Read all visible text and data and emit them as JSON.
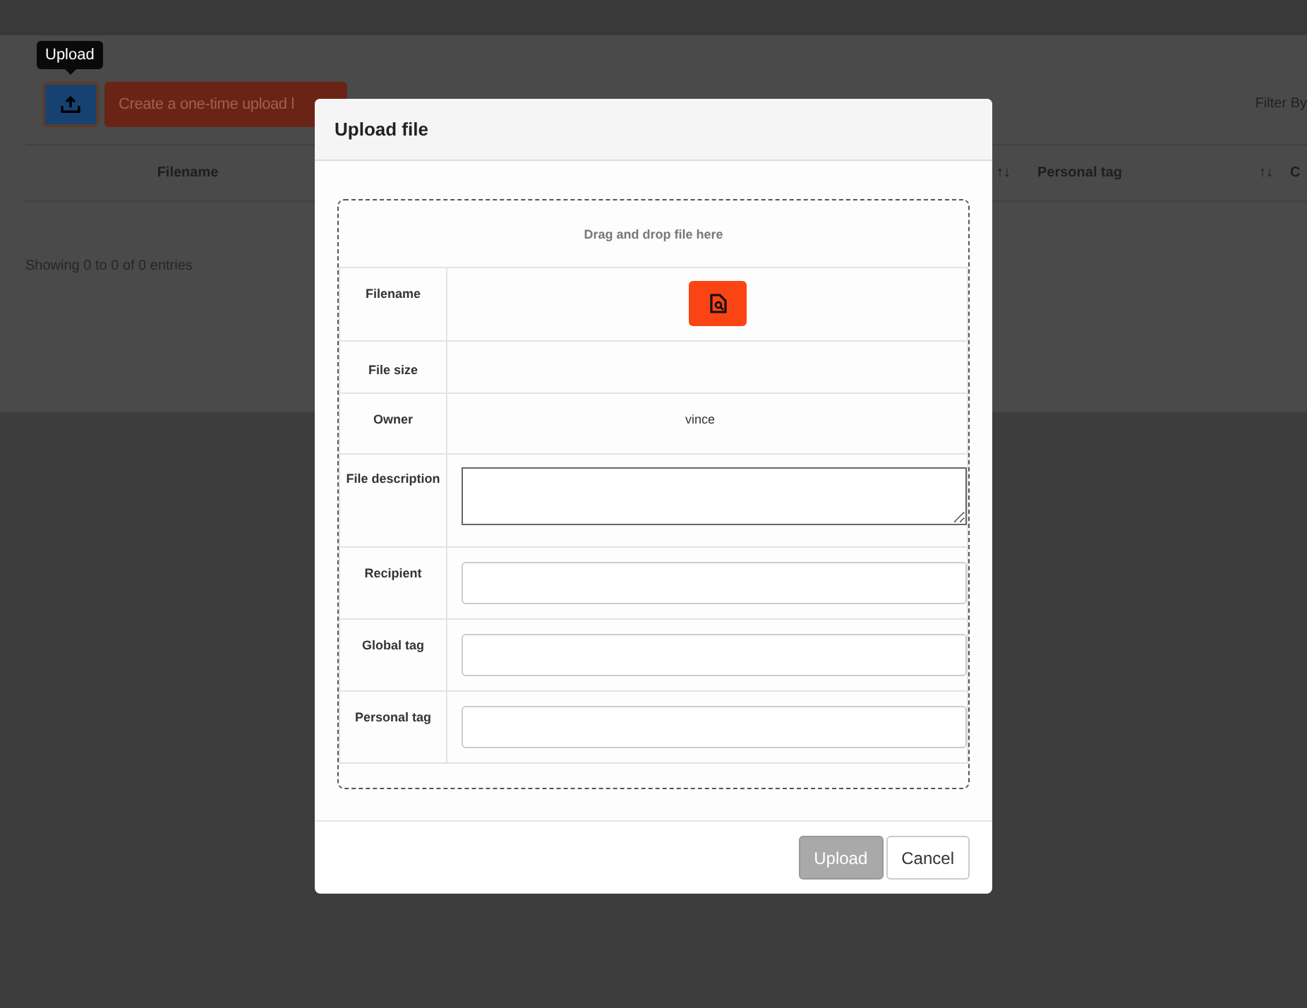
{
  "page": {
    "tooltip": "Upload",
    "link_button": "Create a one-time upload l",
    "filter_label": "Filter By",
    "table": {
      "columns": [
        {
          "label": "Filename"
        },
        {
          "sort_icon": "↑↓"
        },
        {
          "label": "Personal tag",
          "sort_icon": "↑↓"
        },
        {
          "label": "C"
        }
      ]
    },
    "info": "Showing 0 to 0 of 0 entries"
  },
  "modal": {
    "title": "Upload file",
    "dropzone_hint": "Drag and drop file here",
    "rows": [
      {
        "label": "Filename",
        "kind": "file_picker"
      },
      {
        "label": "File size",
        "kind": "blank"
      },
      {
        "label": "Owner",
        "kind": "text",
        "value": "vince"
      },
      {
        "label": "File description",
        "kind": "textarea"
      },
      {
        "label": "Recipient",
        "kind": "input"
      },
      {
        "label": "Global tag",
        "kind": "input"
      },
      {
        "label": "Personal tag",
        "kind": "input"
      }
    ],
    "buttons": [
      {
        "label": "Upload",
        "disabled": true
      },
      {
        "label": "Cancel",
        "disabled": false
      }
    ]
  }
}
